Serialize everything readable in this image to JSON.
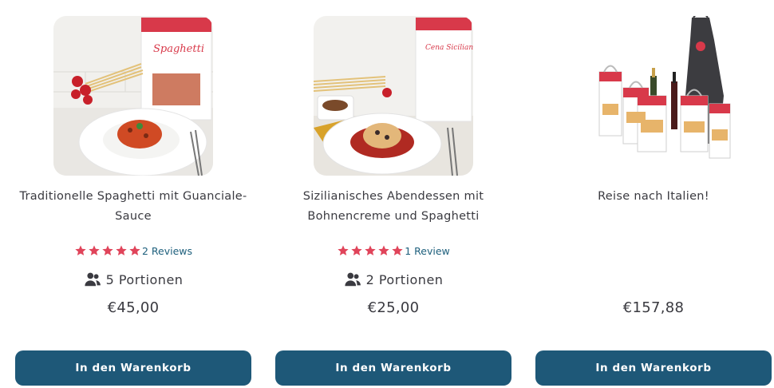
{
  "colors": {
    "accent_button": "#1e5878",
    "star": "#e0445a",
    "review_link": "#1d5f7c",
    "text": "#3a3a40"
  },
  "products": [
    {
      "image_icon": "spaghetti-guanciale-photo",
      "title": "Traditionelle Spaghetti mit Guanciale-Sauce",
      "rating": 5,
      "reviews": "2 Reviews",
      "portions": "5 Portionen",
      "price": "€45,00",
      "cart_label": "In den Warenkorb",
      "package_script": "Spaghetti"
    },
    {
      "image_icon": "cena-siciliana-photo",
      "title": "Sizilianisches Abendessen mit Bohnencreme und Spaghetti",
      "rating": 5,
      "reviews": "1 Review",
      "portions": "2 Portionen",
      "price": "€25,00",
      "cart_label": "In den Warenkorb",
      "package_script": "Cena Siciliana"
    },
    {
      "image_icon": "italy-gift-box-photo",
      "title": "Reise nach Italien!",
      "price": "€157,88",
      "cart_label": "In den Warenkorb"
    }
  ]
}
